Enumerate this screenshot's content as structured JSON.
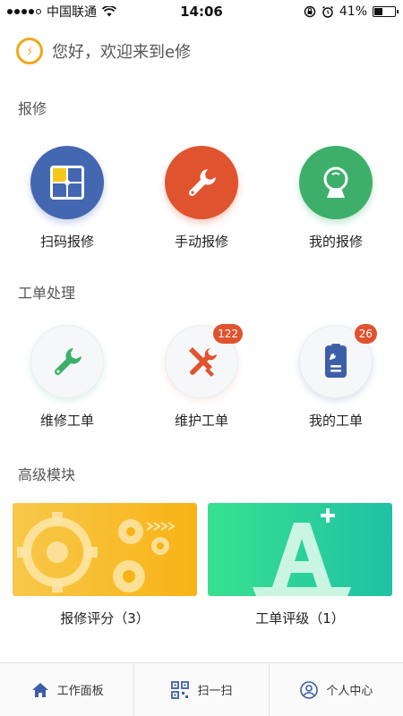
{
  "status_bar": {
    "carrier": "中国联通",
    "time": "14:06",
    "battery": "41%",
    "battery_level": 0.41
  },
  "greeting": "您好，欢迎来到e修",
  "sections": {
    "repair": {
      "title": "报修",
      "items": [
        {
          "label": "扫码报修",
          "icon": "scan-grid-icon"
        },
        {
          "label": "手动报修",
          "icon": "wrench-icon"
        },
        {
          "label": "我的报修",
          "icon": "camera-icon"
        }
      ]
    },
    "work_orders": {
      "title": "工单处理",
      "items": [
        {
          "label": "维修工单",
          "icon": "wrench-icon",
          "badge": ""
        },
        {
          "label": "维护工单",
          "icon": "tools-icon",
          "badge": "122"
        },
        {
          "label": "我的工单",
          "icon": "clipboard-icon",
          "badge": "26"
        }
      ]
    },
    "advanced": {
      "title": "高级模块",
      "cards": [
        {
          "label": "报修评分（3）",
          "icon": "gears-banner"
        },
        {
          "label": "工单评级（1）",
          "icon": "grade-a-plus-banner"
        }
      ]
    }
  },
  "tabbar": [
    {
      "label": "工作面板",
      "icon": "home-icon"
    },
    {
      "label": "扫一扫",
      "icon": "qr-scan-icon"
    },
    {
      "label": "个人中心",
      "icon": "user-icon"
    }
  ],
  "colors": {
    "blue": "#4467b2",
    "orange": "#e0532f",
    "green": "#3daf6a",
    "yellow": "#f7b81e",
    "teal": "#28c99a"
  }
}
